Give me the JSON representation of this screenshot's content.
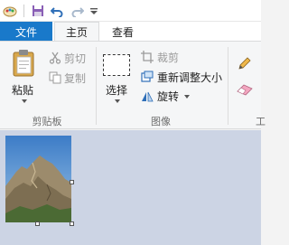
{
  "quick_access": {
    "icons": [
      "paint-app-icon",
      "save-icon",
      "undo-icon",
      "redo-icon",
      "customize-dropdown-icon"
    ]
  },
  "tabs": {
    "file": "文件",
    "home": "主页",
    "view": "查看"
  },
  "clipboard": {
    "paste": "粘贴",
    "cut": "剪切",
    "copy": "复制",
    "group_label": "剪贴板"
  },
  "image_group": {
    "select": "选择",
    "crop": "裁剪",
    "resize": "重新调整大小",
    "rotate": "旋转",
    "group_label": "图像"
  },
  "tools_group": {
    "icons": [
      "pencil-icon",
      "eraser-icon"
    ],
    "group_label_partial": "工"
  },
  "colors": {
    "file_tab": "#1979ca",
    "workspace": "#ccd4e4"
  }
}
